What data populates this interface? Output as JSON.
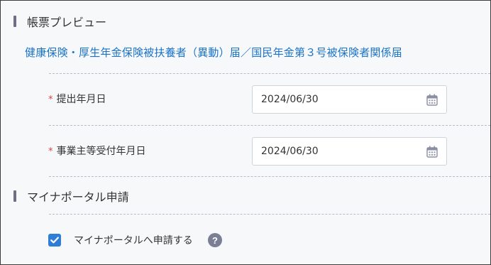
{
  "preview_section": {
    "heading": "帳票プレビュー",
    "form_title": "健康保険・厚生年金保険被扶養者（異動）届／国民年金第３号被保険者関係届"
  },
  "fields": {
    "submission_date": {
      "required_mark": "*",
      "label": "提出年月日",
      "value": "2024/06/30"
    },
    "employer_receipt_date": {
      "required_mark": "*",
      "label": "事業主等受付年月日",
      "value": "2024/06/30"
    }
  },
  "myna_section": {
    "heading": "マイナポータル申請",
    "checkbox_label": "マイナポータルへ申請する",
    "checked": true,
    "help_glyph": "?"
  },
  "colors": {
    "accent_blue": "#1a73c8",
    "checkbox_blue": "#2e7dd6",
    "required_red": "#d64545",
    "section_bar": "#6b7088"
  },
  "icons": {
    "date_picker": "calendar-icon",
    "help": "question-circle-icon",
    "check": "checkmark-icon"
  }
}
